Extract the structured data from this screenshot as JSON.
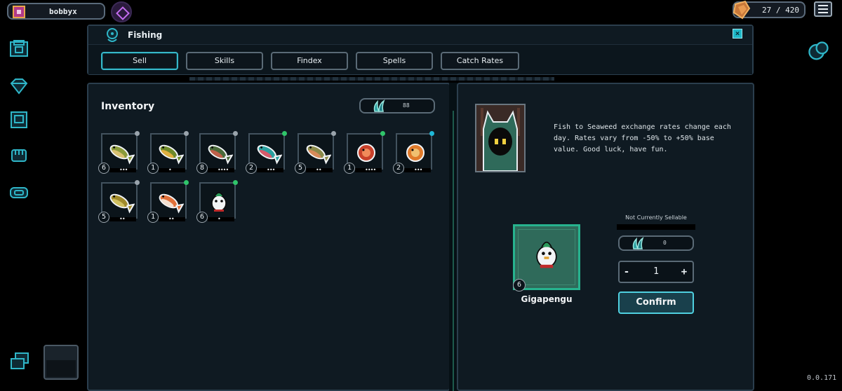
{
  "hud": {
    "username": "bobbyx",
    "currency_text": "27 / 420",
    "version": "0.0.171"
  },
  "window": {
    "title": "Fishing",
    "close_label": "×",
    "tabs": [
      {
        "label": "Sell",
        "active": true
      },
      {
        "label": "Skills",
        "active": false
      },
      {
        "label": "Findex",
        "active": false
      },
      {
        "label": "Spells",
        "active": false
      },
      {
        "label": "Catch Rates",
        "active": false
      }
    ]
  },
  "inventory": {
    "title": "Inventory",
    "seaweed_amount": "88",
    "items": [
      {
        "count": "6",
        "rarity_color": "#9aa4ac",
        "dots": "•••",
        "icon": "fish-olive-icon",
        "body": "#8a9a3a",
        "belly": "#d8c070"
      },
      {
        "count": "1",
        "rarity_color": "#9aa4ac",
        "dots": "•",
        "icon": "fish-green-yellow-icon",
        "body": "#6f8a2a",
        "belly": "#e0b040"
      },
      {
        "count": "8",
        "rarity_color": "#9aa4ac",
        "dots": "••••",
        "icon": "fish-dark-green-icon",
        "body": "#4a6a3a",
        "belly": "#c0604a"
      },
      {
        "count": "2",
        "rarity_color": "#2fc56a",
        "dots": "•••",
        "icon": "fish-teal-icon",
        "body": "#2aa0a0",
        "belly": "#d85a6a"
      },
      {
        "count": "5",
        "rarity_color": "#9aa4ac",
        "dots": "••",
        "icon": "fish-trout-icon",
        "body": "#8a8a4a",
        "belly": "#d88a5a"
      },
      {
        "count": "1",
        "rarity_color": "#2fc56a",
        "dots": "••••",
        "icon": "fish-red-shrimp-icon",
        "body": "#c8402a",
        "belly": "#f08a5a"
      },
      {
        "count": "2",
        "rarity_color": "#1fb8d8",
        "dots": "•••",
        "icon": "fish-orange-puffer-icon",
        "body": "#e07a2a",
        "belly": "#f0c070"
      },
      {
        "count": "5",
        "rarity_color": "#9aa4ac",
        "dots": "••",
        "icon": "fish-yellow-green-icon",
        "body": "#a08a2a",
        "belly": "#d0c060"
      },
      {
        "count": "1",
        "rarity_color": "#2fc56a",
        "dots": "••",
        "icon": "fish-clownfish-icon",
        "body": "#e0703a",
        "belly": "#f4e0d0"
      },
      {
        "count": "6",
        "rarity_color": "#2fc56a",
        "dots": "•",
        "icon": "gigapengu-icon",
        "body": "#2a9a5a",
        "belly": "#f2f4f6"
      }
    ]
  },
  "sell": {
    "npc_text": "Fish to Seaweed exchange rates change each day. Rates vary from -50% to +50% base value. Good luck, have fun.",
    "item_name": "Gigapengu",
    "item_count": "6",
    "status": "Not Currently Sellable",
    "price": "0",
    "quantity": "1",
    "minus_label": "-",
    "plus_label": "+",
    "confirm_label": "Confirm"
  }
}
